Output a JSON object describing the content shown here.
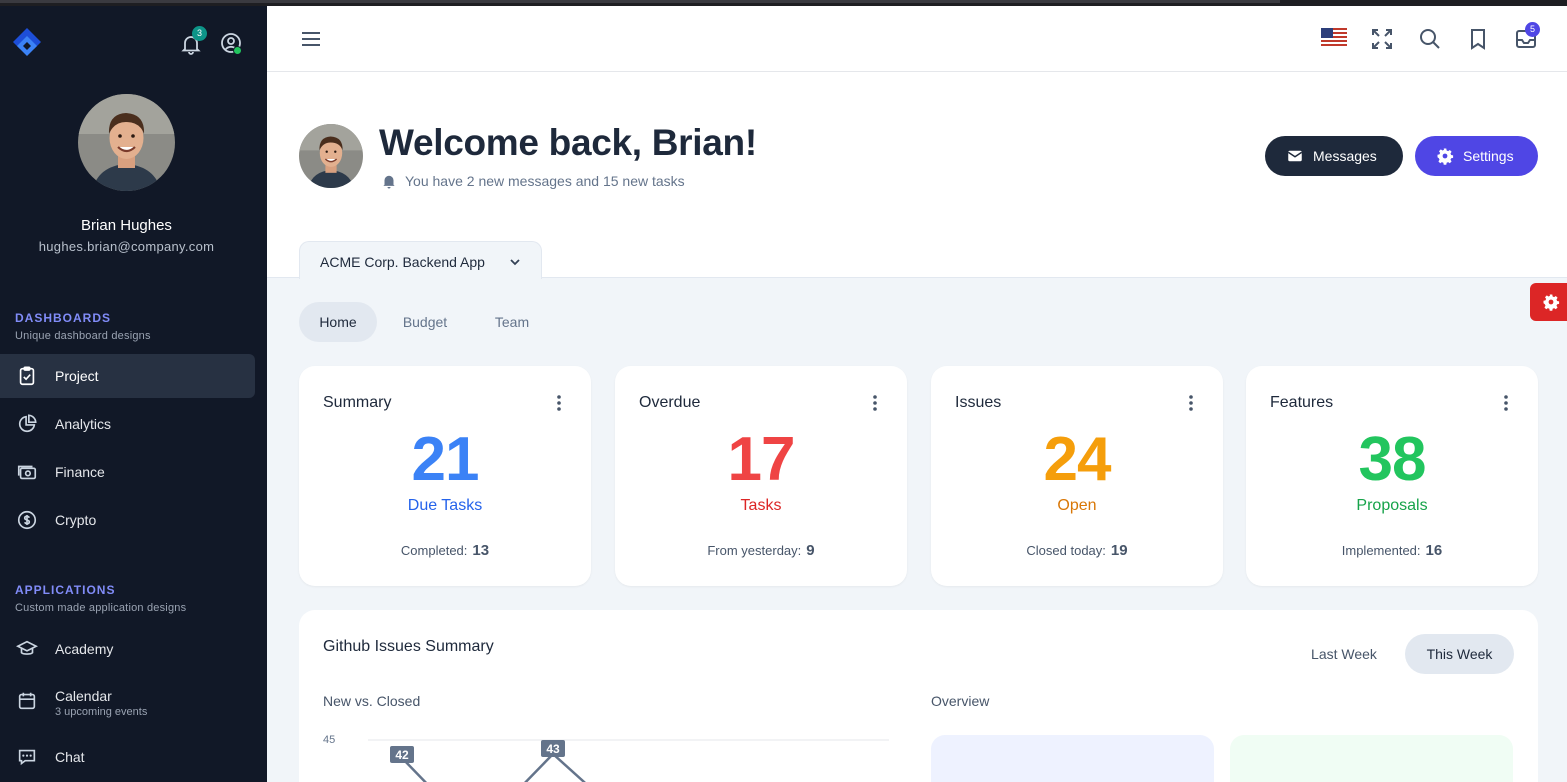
{
  "sidebar": {
    "notifications_count": "3",
    "user": {
      "name": "Brian Hughes",
      "email": "hughes.brian@company.com"
    },
    "groups": [
      {
        "title": "DASHBOARDS",
        "subtitle": "Unique dashboard designs",
        "items": [
          {
            "label": "Project",
            "icon": "clipboard-check-icon",
            "active": true
          },
          {
            "label": "Analytics",
            "icon": "pie-chart-icon"
          },
          {
            "label": "Finance",
            "icon": "cash-icon"
          },
          {
            "label": "Crypto",
            "icon": "currency-dollar-icon"
          }
        ]
      },
      {
        "title": "APPLICATIONS",
        "subtitle": "Custom made application designs",
        "items": [
          {
            "label": "Academy",
            "icon": "academic-cap-icon"
          },
          {
            "label": "Calendar",
            "sub": "3 upcoming events",
            "icon": "calendar-icon"
          },
          {
            "label": "Chat",
            "icon": "chat-icon"
          }
        ]
      }
    ]
  },
  "topbar": {
    "inbox_count": "5"
  },
  "header": {
    "welcome": "Welcome back, Brian!",
    "subtitle": "You have 2 new messages and 15 new tasks",
    "messages_btn": "Messages",
    "settings_btn": "Settings",
    "project": "ACME Corp. Backend App"
  },
  "tabs": [
    "Home",
    "Budget",
    "Team"
  ],
  "cards": [
    {
      "title": "Summary",
      "value": "21",
      "label": "Due Tasks",
      "foot_label": "Completed:",
      "foot_value": "13",
      "color": "#3b82f6",
      "label_color": "#2563eb"
    },
    {
      "title": "Overdue",
      "value": "17",
      "label": "Tasks",
      "foot_label": "From yesterday:",
      "foot_value": "9",
      "color": "#ef4444",
      "label_color": "#dc2626"
    },
    {
      "title": "Issues",
      "value": "24",
      "label": "Open",
      "foot_label": "Closed today:",
      "foot_value": "19",
      "color": "#f59e0b",
      "label_color": "#d97706"
    },
    {
      "title": "Features",
      "value": "38",
      "label": "Proposals",
      "foot_label": "Implemented:",
      "foot_value": "16",
      "color": "#22c55e",
      "label_color": "#16a34a"
    }
  ],
  "github": {
    "title": "Github Issues Summary",
    "ranges": [
      "Last Week",
      "This Week"
    ],
    "active_range": "This Week",
    "chart_label": "New vs. Closed",
    "overview_label": "Overview",
    "chart_data": {
      "type": "line",
      "ytick_top": "45",
      "data_labels": [
        "42",
        "43"
      ]
    }
  }
}
